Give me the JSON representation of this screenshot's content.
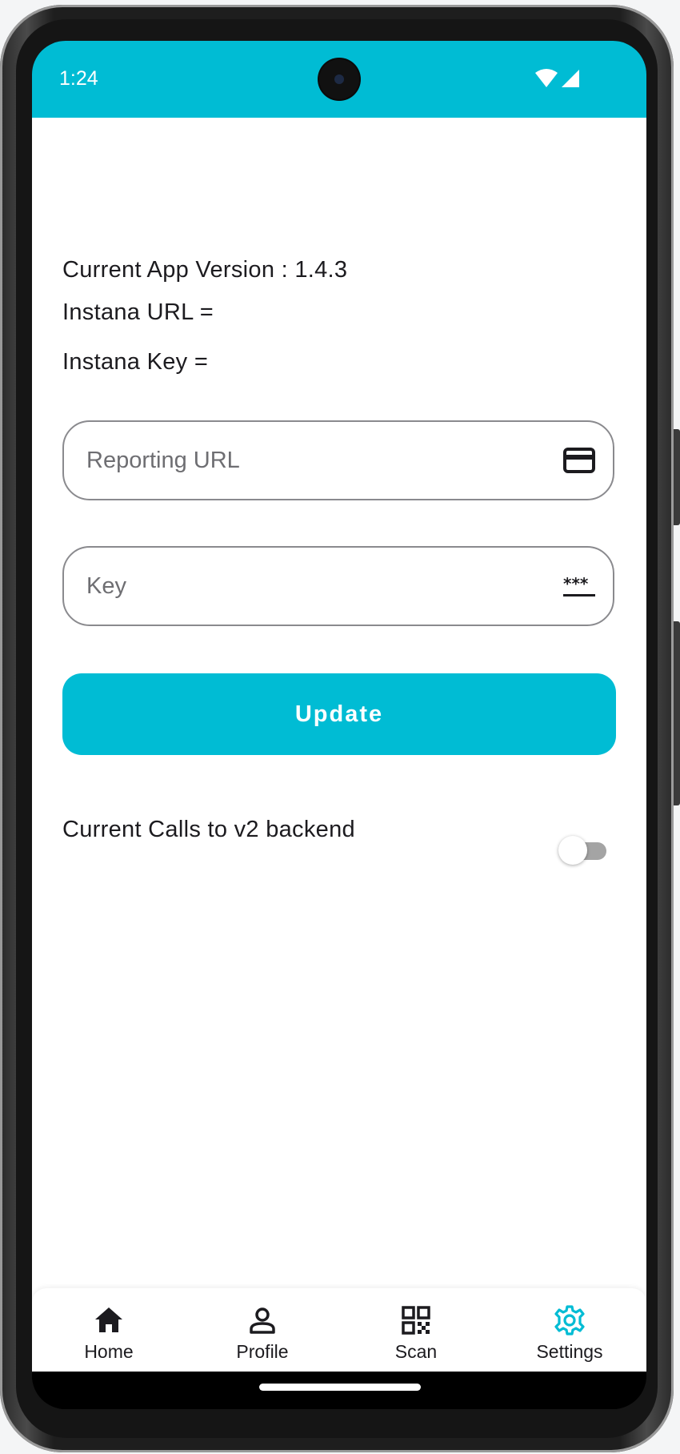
{
  "status_bar": {
    "time": "1:24",
    "wifi_icon": "wifi-icon",
    "signal_icon": "cell-signal-icon",
    "background": "#00bcd4"
  },
  "settings": {
    "app_version": "Current App Version : 1.4.3",
    "instana_url": "Instana URL =",
    "instana_key": "Instana Key =",
    "reporting_url": {
      "value": "",
      "placeholder": "Reporting URL",
      "icon": "credit-card-icon"
    },
    "key": {
      "value": "",
      "placeholder": "Key",
      "icon": "password-icon"
    },
    "update_label": "Update",
    "v2_backend_label": "Current Calls to v2 backend",
    "v2_backend_enabled": false
  },
  "bottom_nav": {
    "items": [
      {
        "label": "Home",
        "icon": "home-icon",
        "selected": false
      },
      {
        "label": "Profile",
        "icon": "person-icon",
        "selected": false
      },
      {
        "label": "Scan",
        "icon": "qr-code-icon",
        "selected": false
      },
      {
        "label": "Settings",
        "icon": "gear-icon",
        "selected": true
      }
    ]
  },
  "colors": {
    "accent": "#00bcd4",
    "text": "#1c1b1f",
    "outline": "#8a8a8e",
    "switch_track_off": "#a4a4a4"
  }
}
